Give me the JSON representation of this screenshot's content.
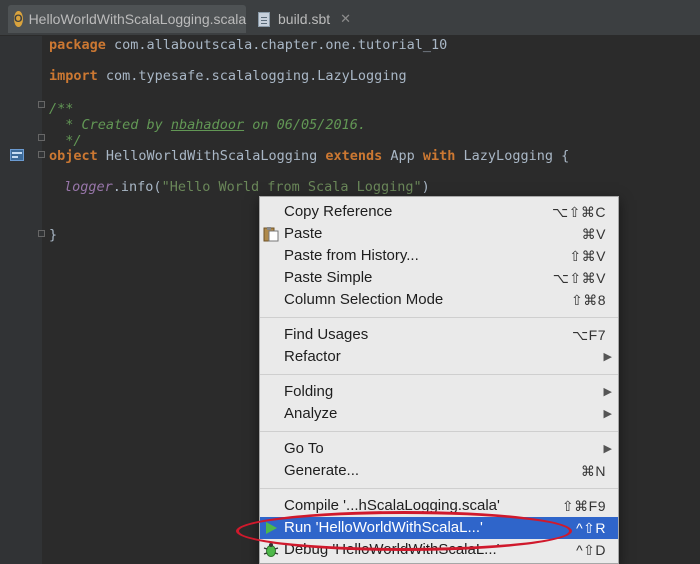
{
  "tabs": [
    {
      "label": "HelloWorldWithScalaLogging.scala",
      "icon": "scala-object-icon",
      "icon_letter": "O",
      "active": true
    },
    {
      "label": "build.sbt",
      "icon": "sbt-file-icon",
      "active": false
    }
  ],
  "code": {
    "line1_kw": "package",
    "line1_rest": " com.allaboutscala.chapter.one.tutorial_10",
    "line2_kw": "import",
    "line2_rest": " com.typesafe.scalalogging.LazyLogging",
    "line3": "/**",
    "line4_a": "  * Created by ",
    "line4_author": "nbahadoor",
    "line4_b": " on 06/05/2016.",
    "line5": "  */",
    "line6_kw1": "object",
    "line6_name": " HelloWorldWithScalaLogging ",
    "line6_kw2": "extends",
    "line6_mid": " App ",
    "line6_kw3": "with",
    "line6_end": " LazyLogging {",
    "line7_field": "logger",
    "line7_mid": ".info(",
    "line7_str": "\"Hello World from Scala Logging\"",
    "line7_end": ")",
    "line8": "}"
  },
  "menu": {
    "copy_reference": {
      "label": "Copy Reference",
      "shortcut": "⌥⇧⌘C"
    },
    "paste": {
      "label": "Paste",
      "shortcut": "⌘V"
    },
    "paste_history": {
      "label": "Paste from History...",
      "shortcut": "⇧⌘V"
    },
    "paste_simple": {
      "label": "Paste Simple",
      "shortcut": "⌥⇧⌘V"
    },
    "column_selection": {
      "label": "Column Selection Mode",
      "shortcut": "⇧⌘8"
    },
    "find_usages": {
      "label": "Find Usages",
      "shortcut": "⌥F7"
    },
    "refactor": {
      "label": "Refactor"
    },
    "folding": {
      "label": "Folding"
    },
    "analyze": {
      "label": "Analyze"
    },
    "go_to": {
      "label": "Go To"
    },
    "generate": {
      "label": "Generate...",
      "shortcut": "⌘N"
    },
    "compile": {
      "label": "Compile '...hScalaLogging.scala'",
      "shortcut": "⇧⌘F9"
    },
    "run": {
      "label": "Run 'HelloWorldWithScalaL...'",
      "shortcut": "^⇧R"
    },
    "debug": {
      "label": "Debug 'HelloWorldWithScalaL...'",
      "shortcut": "^⇧D"
    }
  },
  "colors": {
    "selected": "#2f65ca",
    "highlight_ellipse": "#d0192c",
    "editor_bg": "#2b2b2b"
  }
}
